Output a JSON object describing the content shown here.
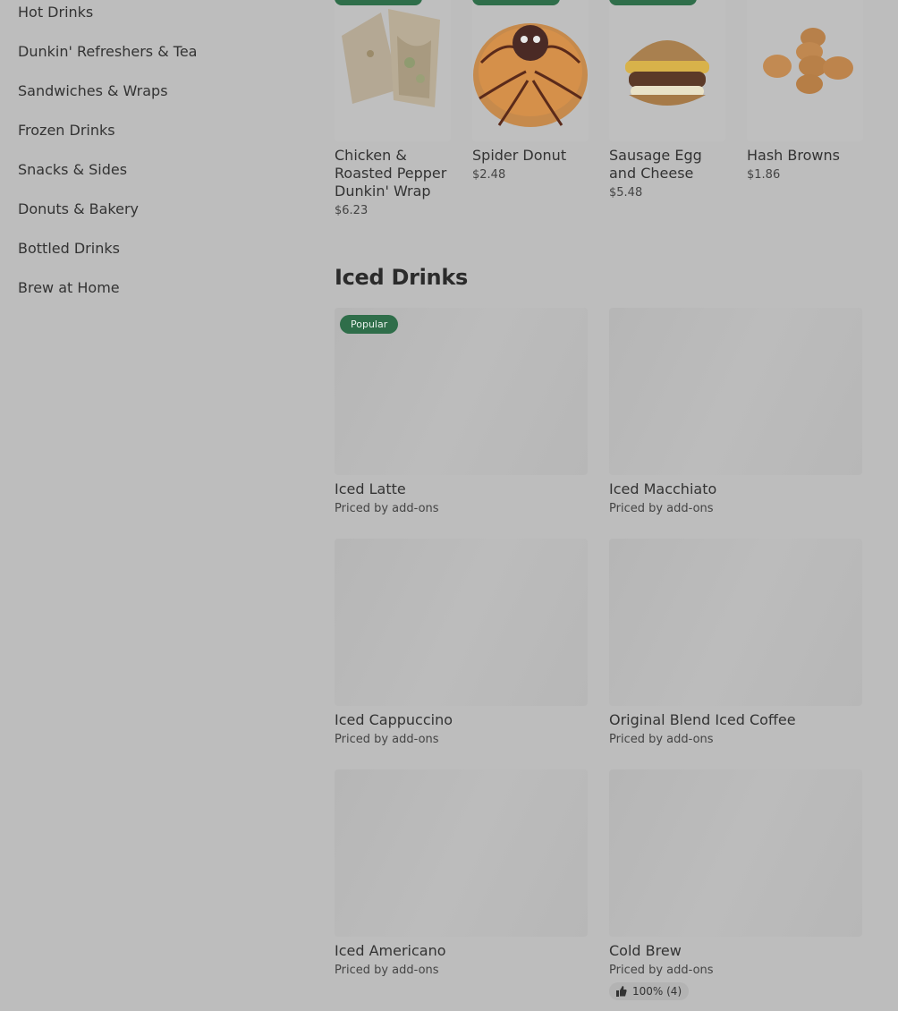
{
  "sidebar": {
    "items": [
      {
        "label": "Hot Drinks"
      },
      {
        "label": "Dunkin' Refreshers & Tea"
      },
      {
        "label": "Sandwiches & Wraps"
      },
      {
        "label": "Frozen Drinks"
      },
      {
        "label": "Snacks & Sides"
      },
      {
        "label": "Donuts & Bakery"
      },
      {
        "label": "Bottled Drinks"
      },
      {
        "label": "Brew at Home"
      }
    ]
  },
  "top_items": [
    {
      "name": "Chicken & Roasted Pepper Dunkin' Wrap",
      "price": "$6.23",
      "image": "wrap"
    },
    {
      "name": "Spider Donut",
      "price": "$2.48",
      "image": "donut"
    },
    {
      "name": "Sausage Egg and Cheese",
      "price": "$5.48",
      "image": "sandwich"
    },
    {
      "name": "Hash Browns",
      "price": "$1.86",
      "image": "hashbrowns"
    }
  ],
  "iced_drinks": {
    "title": "Iced Drinks",
    "items": [
      {
        "name": "Iced Latte",
        "price": "Priced by add-ons",
        "badge": "Popular"
      },
      {
        "name": "Iced Macchiato",
        "price": "Priced by add-ons"
      },
      {
        "name": "Iced Cappuccino",
        "price": "Priced by add-ons"
      },
      {
        "name": "Original Blend Iced Coffee",
        "price": "Priced by add-ons"
      },
      {
        "name": "Iced Americano",
        "price": "Priced by add-ons"
      },
      {
        "name": "Cold Brew",
        "price": "Priced by add-ons",
        "rating": "100% (4)"
      }
    ]
  },
  "colors": {
    "accent": "#2f6e4a",
    "overlay": "#bdbdbd"
  }
}
